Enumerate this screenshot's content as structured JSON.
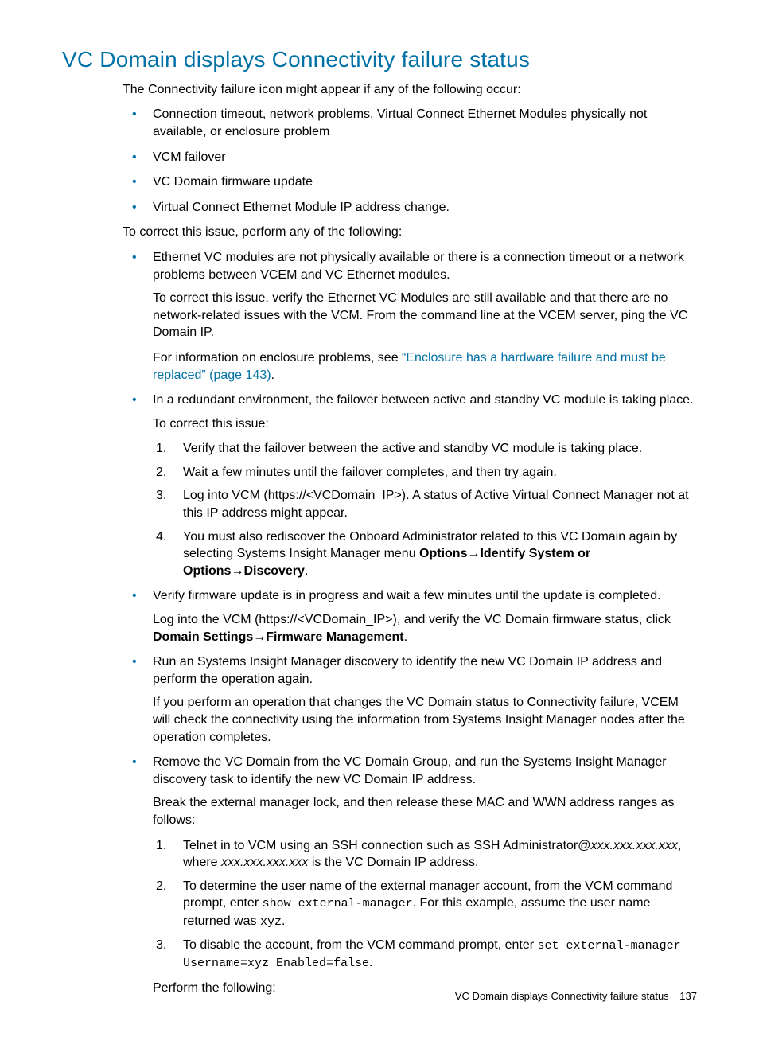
{
  "heading": "VC Domain displays Connectivity failure status",
  "intro": "The Connectivity failure icon might appear if any of the following occur:",
  "causes": [
    "Connection timeout, network problems, Virtual Connect Ethernet Modules physically not available, or enclosure problem",
    "VCM failover",
    "VC Domain firmware update",
    "Virtual Connect Ethernet Module IP address change."
  ],
  "correct_intro": "To correct this issue, perform any of the following:",
  "item1": {
    "p1": "Ethernet VC modules are not physically available or there is a connection timeout or a network problems between VCEM and VC Ethernet modules.",
    "p2": "To correct this issue, verify the Ethernet VC Modules are still available and that there are no network-related issues with the VCM. From the command line at the VCEM server, ping the VC Domain IP.",
    "p3a": "For information on enclosure problems, see ",
    "p3link": "“Enclosure has a hardware failure and must be replaced” (page 143)",
    "p3b": "."
  },
  "item2": {
    "p1": "In a redundant environment, the failover between active and standby VC module is taking place.",
    "p2": "To correct this issue:",
    "steps": {
      "s1": "Verify that the failover between the active and standby VC module is taking place.",
      "s2": "Wait a few minutes until the failover completes, and then try again.",
      "s3": "Log into VCM (https://<VCDomain_IP>). A status of Active Virtual Connect Manager not at this IP address might appear.",
      "s4a": "You must also rediscover the Onboard Administrator related to this VC Domain again by selecting Systems Insight Manager menu ",
      "s4b1": "Options",
      "s4arrow": "→",
      "s4b2": "Identify System or Options",
      "s4b3": "Discovery",
      "s4end": "."
    }
  },
  "item3": {
    "p1": "Verify firmware update is in progress and wait a few minutes until the update is completed.",
    "p2a": "Log into the VCM (https://<VCDomain_IP>), and verify the VC Domain firmware status, click ",
    "p2b1": "Domain Settings",
    "p2arrow": "→",
    "p2b2": "Firmware Management",
    "p2end": "."
  },
  "item4": {
    "p1": "Run an Systems Insight Manager discovery to identify the new VC Domain IP address and perform the operation again.",
    "p2": "If you perform an operation that changes the VC Domain status to Connectivity failure, VCEM will check the connectivity using the information from Systems Insight Manager nodes after the operation completes."
  },
  "item5": {
    "p1": "Remove the VC Domain from the VC Domain Group, and run the Systems Insight Manager discovery task to identify the new VC Domain IP address.",
    "p2": "Break the external manager lock, and then release these MAC and WWN address ranges as follows:",
    "steps": {
      "s1a": "Telnet in to VCM using an SSH connection such as SSH Administrator@",
      "s1b": "xxx.xxx.xxx.xxx",
      "s1c": ", where ",
      "s1d": "xxx.xxx.xxx.xxx",
      "s1e": " is the VC Domain IP address.",
      "s2a": "To determine the user name of the external manager account, from the VCM command prompt, enter ",
      "s2b": "show external-manager",
      "s2c": ". For this example, assume the user name returned was ",
      "s2d": "xyz",
      "s2e": ".",
      "s3a": "To disable the account, from the VCM command prompt, enter ",
      "s3b": "set external-manager Username=xyz Enabled=false",
      "s3c": "."
    },
    "p3": "Perform the following:"
  },
  "footer": {
    "title": "VC Domain displays Connectivity failure status",
    "page": "137"
  }
}
